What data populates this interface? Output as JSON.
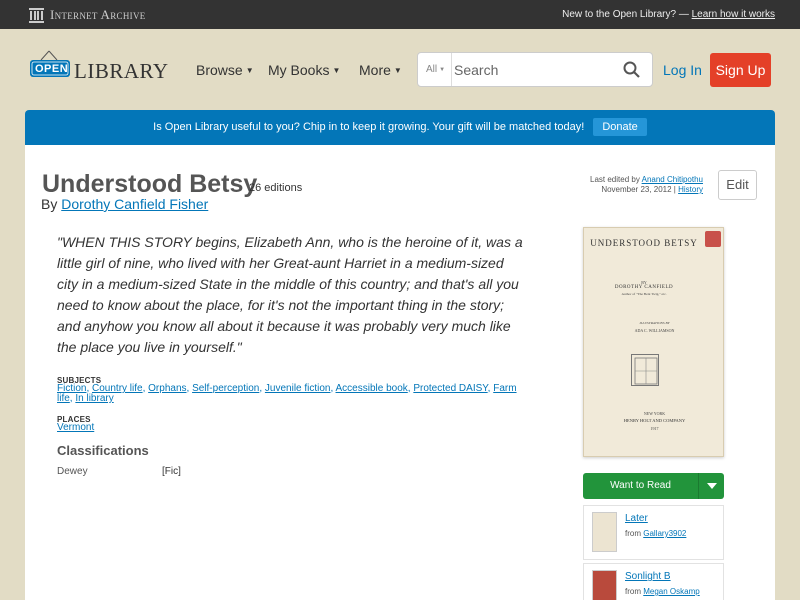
{
  "ia_bar": {
    "logo_text": "Internet Archive",
    "right_text": "New to the Open Library? —",
    "right_link": "Learn how it works"
  },
  "header": {
    "logo_open": "OPEN",
    "logo_library": "LIBRARY",
    "nav": [
      {
        "label": "Browse"
      },
      {
        "label": "My Books"
      },
      {
        "label": "More"
      }
    ],
    "search": {
      "scope": "All",
      "placeholder": "Search",
      "value": ""
    },
    "login_label": "Log In",
    "signup_label": "Sign Up"
  },
  "donate": {
    "text": "Is Open Library useful to you? Chip in to keep it growing. Your gift will be matched today!",
    "button_label": "Donate"
  },
  "book": {
    "title": "Understood Betsy",
    "editions": "26 editions",
    "by_prefix": "By",
    "author": "Dorothy Canfield Fisher",
    "last_edited_prefix": "Last edited by",
    "last_edited_by": "Anand Chitipothu",
    "last_edited_date": "November 23, 2012",
    "history_label": "History",
    "edit_label": "Edit",
    "description": "\"WHEN THIS STORY begins, Elizabeth Ann, who is the heroine of it, was a little girl of nine, who lived with her Great-aunt Harriet in a medium-sized city in a medium-sized State in the middle of this country; and that's all you need to know about the place, for it's not the important thing in the story; and anyhow you know all about it because it was probably very much like the place you live in yourself.\"",
    "subjects_label": "SUBJECTS",
    "subjects": [
      "Fiction",
      "Country life",
      "Orphans",
      "Self-perception",
      "Juvenile fiction",
      "Accessible book",
      "Protected DAISY",
      "Farm life",
      "In library"
    ],
    "places_label": "PLACES",
    "places": [
      "Vermont"
    ],
    "classifications_label": "Classifications",
    "dewey_label": "Dewey",
    "dewey_value": "[Fic]"
  },
  "cover": {
    "title": "UNDERSTOOD BETSY",
    "by": "BY",
    "author": "DOROTHY CANFIELD",
    "author_sub": "Author of \"The Bent Twig,\" etc.",
    "illustrations_label": "ILLUSTRATIONS BY",
    "illustrator": "ADA C. WILLIAMSON",
    "pub_city": "NEW YORK",
    "publisher": "HENRY HOLT AND COMPANY",
    "year": "1917"
  },
  "sidebar": {
    "want_to_read_label": "Want to Read",
    "lists": [
      {
        "name": "Later",
        "from_prefix": "from",
        "owner": "Gallary3902"
      },
      {
        "name": "Sonlight B",
        "from_prefix": "from",
        "owner": "Megan Oskamp"
      }
    ]
  },
  "colors": {
    "background": "#e2dcc5",
    "accent_blue": "#0376b8",
    "signup_red": "#e44028",
    "want_to_read_green": "#22943b",
    "topbar": "#333333"
  }
}
